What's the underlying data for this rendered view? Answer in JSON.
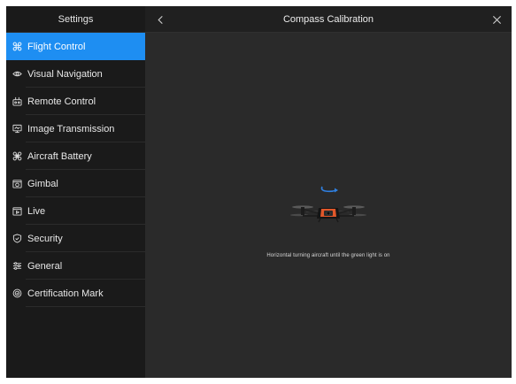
{
  "sidebar": {
    "title": "Settings",
    "items": [
      {
        "label": "Flight Control",
        "icon": "drone-icon",
        "active": true
      },
      {
        "label": "Visual Navigation",
        "icon": "eye-icon",
        "active": false
      },
      {
        "label": "Remote Control",
        "icon": "remote-controller-icon",
        "active": false
      },
      {
        "label": "Image Transmission",
        "icon": "monitor-icon",
        "active": false
      },
      {
        "label": "Aircraft Battery",
        "icon": "battery-icon",
        "active": false
      },
      {
        "label": "Gimbal",
        "icon": "camera-icon",
        "active": false
      },
      {
        "label": "Live",
        "icon": "live-icon",
        "active": false
      },
      {
        "label": "Security",
        "icon": "shield-icon",
        "active": false
      },
      {
        "label": "General",
        "icon": "sliders-icon",
        "active": false
      },
      {
        "label": "Certification Mark",
        "icon": "certification-icon",
        "active": false
      }
    ]
  },
  "main": {
    "title": "Compass Calibration",
    "back_icon": "chevron-left-icon",
    "close_icon": "close-icon",
    "illustration_icon": "aircraft-rotation-icon",
    "instruction": "Horizontal turning aircraft until the green light is on"
  },
  "colors": {
    "active": "#1e8ef2",
    "sidebar_bg": "#1a1a1a",
    "main_bg": "#2a2a2a",
    "rotation_arrow": "#2f7fe0",
    "aircraft_orange": "#e0572a"
  }
}
